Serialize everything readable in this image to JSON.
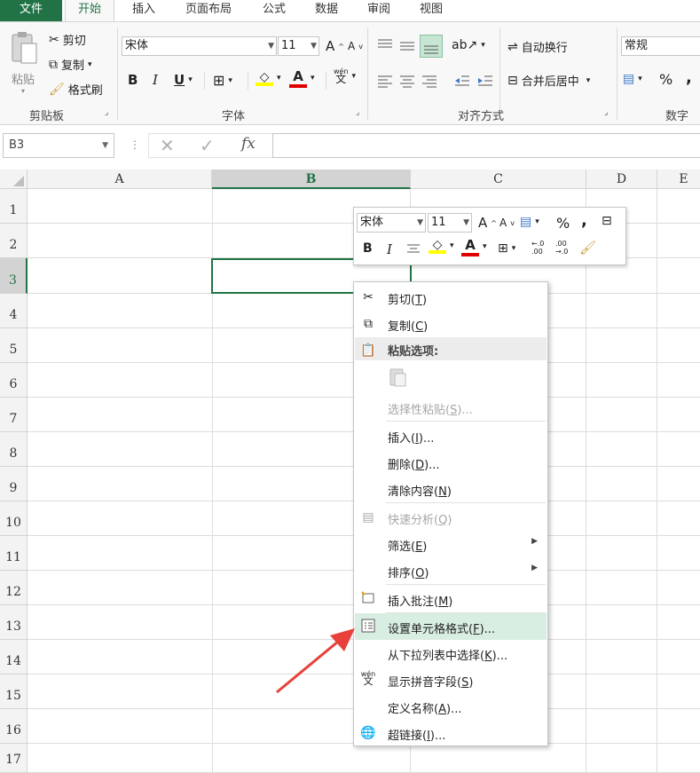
{
  "tabs": {
    "file": "文件",
    "home": "开始",
    "insert": "插入",
    "page_layout": "页面布局",
    "formulas": "公式",
    "data": "数据",
    "review": "审阅",
    "view": "视图"
  },
  "clipboard": {
    "paste": "粘贴",
    "cut": "剪切",
    "copy": "复制",
    "format_painter": "格式刷",
    "group": "剪贴板"
  },
  "font": {
    "name": "宋体",
    "size": "11",
    "group": "字体",
    "bold": "B",
    "italic": "I",
    "underline": "U",
    "font_color_letter": "A",
    "grow": "A",
    "shrink": "A",
    "phonetic": "wén"
  },
  "alignment": {
    "wrap": "自动换行",
    "merge": "合并后居中",
    "group": "对齐方式"
  },
  "number": {
    "format": "常规",
    "group": "数字",
    "percent": "%",
    "comma": ","
  },
  "formula_bar": {
    "name_box": "B3",
    "fx": "fx",
    "value": ""
  },
  "columns": [
    "A",
    "B",
    "C",
    "D",
    "E"
  ],
  "rows": [
    "1",
    "2",
    "3",
    "4",
    "5",
    "6",
    "7",
    "8",
    "9",
    "10",
    "11",
    "12",
    "13",
    "14",
    "15",
    "16",
    "17"
  ],
  "mini_toolbar": {
    "font": "宋体",
    "size": "11",
    "bold": "B",
    "italic": "I",
    "percent": "%",
    "comma": ",",
    "font_color_letter": "A",
    "inc_decimal": ".00",
    "dec_decimal": ".00"
  },
  "context_menu": {
    "cut": {
      "text": "剪切(",
      "key": "T",
      "tail": ")"
    },
    "copy": {
      "text": "复制(",
      "key": "C",
      "tail": ")"
    },
    "paste_options": "粘贴选项:",
    "paste_special": {
      "text": "选择性粘贴(",
      "key": "S",
      "tail": ")..."
    },
    "insert": {
      "text": "插入(",
      "key": "I",
      "tail": ")..."
    },
    "delete": {
      "text": "删除(",
      "key": "D",
      "tail": ")..."
    },
    "clear": {
      "text": "清除内容(",
      "key": "N",
      "tail": ")"
    },
    "quick_analysis": {
      "text": "快速分析(",
      "key": "Q",
      "tail": ")"
    },
    "filter": {
      "text": "筛选(",
      "key": "E",
      "tail": ")"
    },
    "sort": {
      "text": "排序(",
      "key": "O",
      "tail": ")"
    },
    "insert_comment": {
      "text": "插入批注(",
      "key": "M",
      "tail": ")"
    },
    "format_cells": {
      "text": "设置单元格格式(",
      "key": "F",
      "tail": ")..."
    },
    "pick_list": {
      "text": "从下拉列表中选择(",
      "key": "K",
      "tail": ")..."
    },
    "phonetic": {
      "text": "显示拼音字段(",
      "key": "S",
      "tail": ")"
    },
    "define_name": {
      "text": "定义名称(",
      "key": "A",
      "tail": ")..."
    },
    "hyperlink": {
      "text": "超链接(",
      "key": "I",
      "tail": ")..."
    }
  },
  "colors": {
    "accent": "#217346",
    "highlight": "#d9eee2",
    "arrow": "#e8413a",
    "font_red": "#e00000",
    "fill_yellow": "#ffff00"
  }
}
